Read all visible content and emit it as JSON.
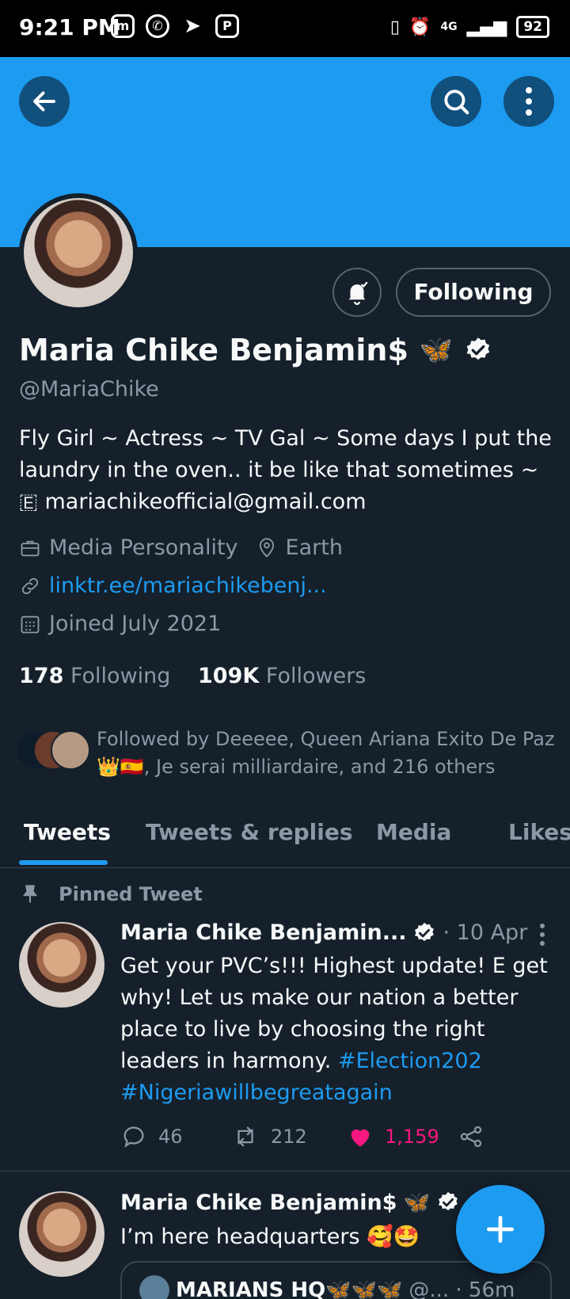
{
  "status_bar": {
    "time": "9:21 PM",
    "battery": "92",
    "network": "4G"
  },
  "header": {
    "back_icon": "arrow-left-icon",
    "search_icon": "search-icon",
    "more_icon": "more-vertical-icon",
    "banner_color": "#1d9bf0"
  },
  "profile": {
    "name": "Maria Chike Benjamin$",
    "name_emoji": "🦋",
    "handle": "@MariaChike",
    "following_button": "Following",
    "bio_line1": "Fly Girl ~ Actress ~ TV Gal ~ Some days I put the",
    "bio_line2": "laundry in the oven.. it be like that sometimes ~",
    "bio_line3_emoji": "🇪",
    "bio_line3": "mariachikeofficial@gmail.com",
    "category": "Media Personality",
    "location": "Earth",
    "link": "linktr.ee/mariachikebenj...",
    "joined": "Joined July 2021",
    "following_count": "178",
    "following_label": "Following",
    "followers_count": "109K",
    "followers_label": "Followers",
    "followed_by_line1": "Followed by Deeeee, Queen Ariana Exito De Paz",
    "followed_by_line2": "👑🇪🇸, Je serai milliardaire, and 216 others"
  },
  "tabs": [
    "Tweets",
    "Tweets & replies",
    "Media",
    "Likes"
  ],
  "pinned_label": "Pinned Tweet",
  "tweets": [
    {
      "author": "Maria Chike Benjamin...",
      "meta": "· 10 Apr",
      "text_lines": [
        "Get your PVC’s!!!  Highest update! E get",
        "why! Let us make our nation a better",
        "place to live by choosing the right"
      ],
      "text_last_plain": "leaders in harmony. ",
      "hashtag1": "#Election202",
      "hashtag2": "#Nigeriawillbegreatagain",
      "replies": "46",
      "retweets": "212",
      "likes": "1,159"
    },
    {
      "author": "Maria Chike Benjamin$",
      "author_emoji": "🦋",
      "meta": "· ...",
      "text": "I’m here headquarters 🥰🤩",
      "quote_author": "MARIANS HQ🦋🦋🦋",
      "quote_meta": "@... · 56m"
    }
  ],
  "colors": {
    "accent": "#1d9bf0",
    "like": "#f91880",
    "background": "#15202b",
    "muted": "#8b98a5"
  }
}
